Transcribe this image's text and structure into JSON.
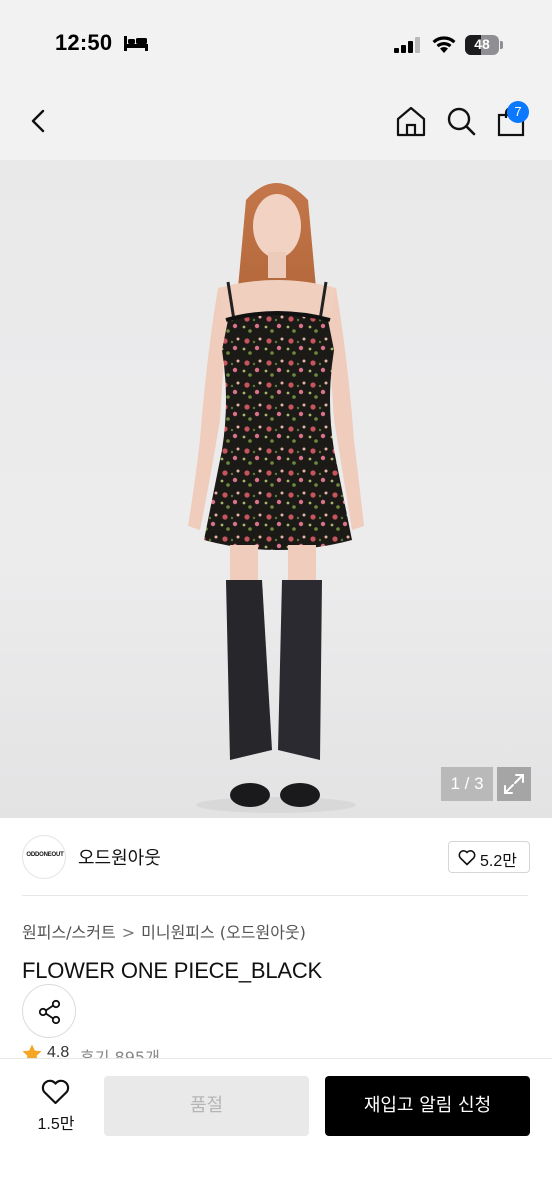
{
  "status_bar": {
    "time": "12:50",
    "battery_level": "48",
    "battery_fraction": 0.48
  },
  "nav": {
    "cart_count": "7",
    "accent_color": "#0a78ff"
  },
  "gallery": {
    "counter": "1 / 3",
    "current": 1,
    "total": 3
  },
  "brand": {
    "logo_text": "ODDONEOUT",
    "name": "오드원아웃",
    "likes": "5.2만"
  },
  "breadcrumb": {
    "category": "원피스/스커트",
    "separator": ">",
    "subcategory": "미니원피스 (오드원아웃)"
  },
  "product": {
    "title": "FLOWER ONE PIECE_BLACK",
    "rating": "4.8",
    "review_label": "후기 895개"
  },
  "bottom_bar": {
    "wish_count": "1.5만",
    "soldout_label": "품절",
    "restock_label": "재입고 알림 신청"
  },
  "icons": {
    "back": "chevron-left-icon",
    "home": "home-icon",
    "search": "search-icon",
    "bag": "shopping-bag-icon",
    "share": "share-icon",
    "heart": "heart-icon",
    "star": "star-icon",
    "expand": "expand-icon"
  },
  "colors": {
    "star": "#f5a623",
    "primary_button": "#000000",
    "disabled_button": "#e9e9e9"
  }
}
